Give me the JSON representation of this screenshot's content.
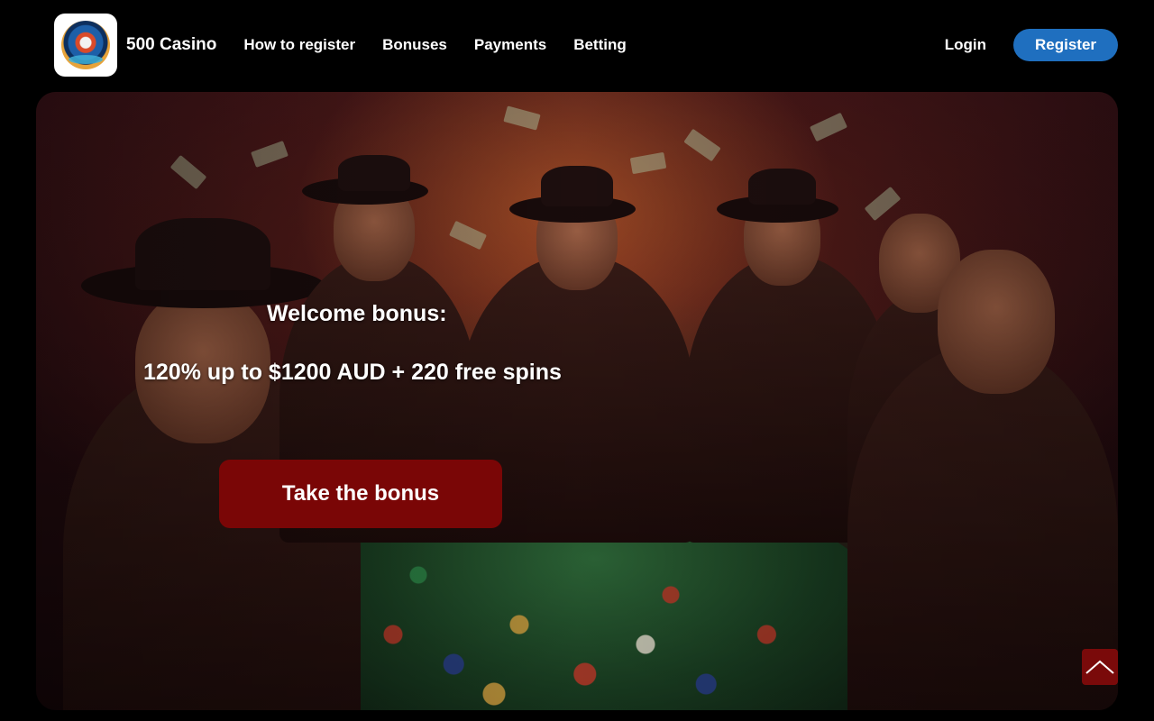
{
  "header": {
    "brand": "500 Casino",
    "nav": [
      {
        "label": "How to register"
      },
      {
        "label": "Bonuses"
      },
      {
        "label": "Payments"
      },
      {
        "label": "Betting"
      }
    ],
    "login_label": "Login",
    "register_label": "Register"
  },
  "hero": {
    "title": "Welcome bonus:",
    "offer": "120% up to $1200 AUD + 220 free spins",
    "cta_label": "Take the bonus",
    "image_icon": "poker-table-illustration"
  },
  "scroll_top": {
    "icon": "chevron-up-icon"
  },
  "colors": {
    "background": "#000000",
    "register_button": "#1f6fbf",
    "cta_button": "#7a0606",
    "scroll_top_button": "#7a0a0a"
  }
}
